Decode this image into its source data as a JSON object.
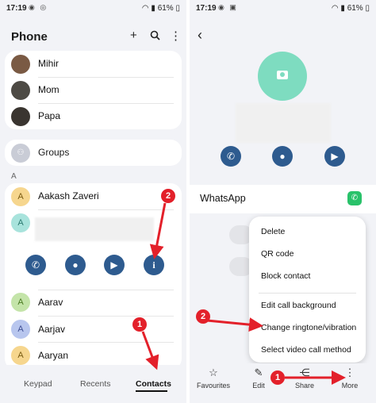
{
  "left_screen": {
    "status": {
      "time": "17:19",
      "battery": "61%"
    },
    "header": {
      "title": "Phone",
      "add_icon": "plus-icon",
      "search_icon": "search-icon",
      "more_icon": "more-vertical-icon"
    },
    "favorites": [
      {
        "name": "Mihir"
      },
      {
        "name": "Mom"
      },
      {
        "name": "Papa"
      }
    ],
    "groups_label": "Groups",
    "section_letter": "A",
    "contacts": [
      {
        "name": "Aakash Zaveri",
        "initial": "A"
      },
      {
        "name": "",
        "initial": "A"
      },
      {
        "name": "Aarav",
        "initial": "A"
      },
      {
        "name": "Aarjav",
        "initial": "A"
      },
      {
        "name": "Aaryan",
        "initial": "A"
      }
    ],
    "expanded_actions": [
      "phone-icon",
      "message-icon",
      "video-icon",
      "info-icon"
    ],
    "tabs": [
      "Keypad",
      "Recents",
      "Contacts"
    ],
    "active_tab": "Contacts",
    "step_badges": [
      "2",
      "1"
    ]
  },
  "right_screen": {
    "status": {
      "time": "17:19",
      "battery": "61%"
    },
    "back_icon": "back-arrow-icon",
    "actions": [
      "phone-icon",
      "message-icon",
      "video-icon"
    ],
    "whatsapp_label": "WhatsApp",
    "menu": {
      "items_top": [
        "Delete",
        "QR code",
        "Block contact"
      ],
      "items_bottom": [
        "Edit call background",
        "Change ringtone/vibration",
        "Select video call method"
      ]
    },
    "bottom_tabs": [
      {
        "label": "Favourites",
        "icon": "star-icon"
      },
      {
        "label": "Edit",
        "icon": "pencil-icon"
      },
      {
        "label": "Share",
        "icon": "share-icon"
      },
      {
        "label": "More",
        "icon": "more-vertical-icon"
      }
    ],
    "step_badges": [
      "2",
      "1"
    ]
  },
  "colors": {
    "accent_blue": "#2e5b8f",
    "badge_red": "#e3202a",
    "avatar_mint": "#7edcc0",
    "whatsapp_green": "#29c26a"
  }
}
